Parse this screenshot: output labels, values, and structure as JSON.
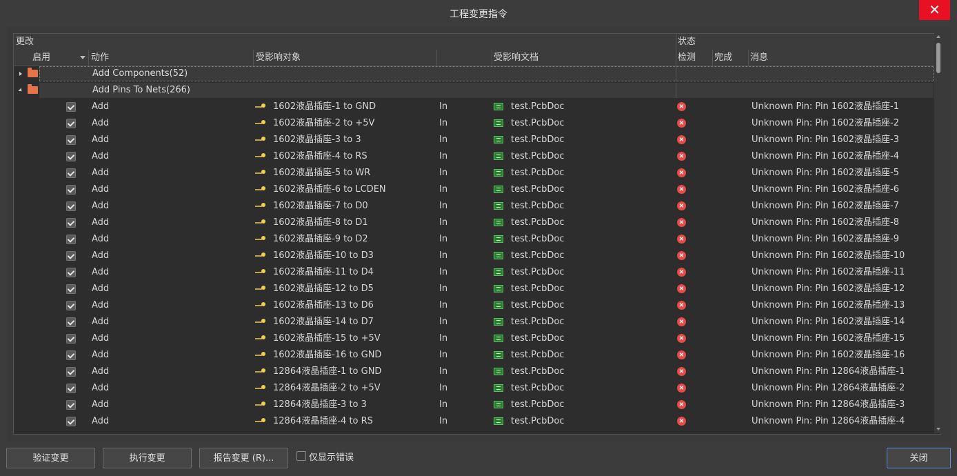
{
  "window": {
    "title": "工程变更指令",
    "close_glyph": "✕"
  },
  "groups": {
    "modify": "更改",
    "status": "状态"
  },
  "columns": {
    "enable": "启用",
    "action": "动作",
    "affected_object": "受影响对象",
    "affected_doc": "受影响文档",
    "check": "检测",
    "done": "完成",
    "message": "消息"
  },
  "tree": [
    {
      "label": "Add Components(52)",
      "expanded": false
    },
    {
      "label": "Add Pins To Nets(266)",
      "expanded": true
    }
  ],
  "rows": [
    {
      "action": "Add",
      "object": "1602液晶插座-1 to GND",
      "dir": "In",
      "doc": "test.PcbDoc",
      "message": "Unknown Pin: Pin 1602液晶插座-1"
    },
    {
      "action": "Add",
      "object": "1602液晶插座-2 to +5V",
      "dir": "In",
      "doc": "test.PcbDoc",
      "message": "Unknown Pin: Pin 1602液晶插座-2"
    },
    {
      "action": "Add",
      "object": "1602液晶插座-3 to 3",
      "dir": "In",
      "doc": "test.PcbDoc",
      "message": "Unknown Pin: Pin 1602液晶插座-3"
    },
    {
      "action": "Add",
      "object": "1602液晶插座-4 to RS",
      "dir": "In",
      "doc": "test.PcbDoc",
      "message": "Unknown Pin: Pin 1602液晶插座-4"
    },
    {
      "action": "Add",
      "object": "1602液晶插座-5 to WR",
      "dir": "In",
      "doc": "test.PcbDoc",
      "message": "Unknown Pin: Pin 1602液晶插座-5"
    },
    {
      "action": "Add",
      "object": "1602液晶插座-6 to LCDEN",
      "dir": "In",
      "doc": "test.PcbDoc",
      "message": "Unknown Pin: Pin 1602液晶插座-6"
    },
    {
      "action": "Add",
      "object": "1602液晶插座-7 to D0",
      "dir": "In",
      "doc": "test.PcbDoc",
      "message": "Unknown Pin: Pin 1602液晶插座-7"
    },
    {
      "action": "Add",
      "object": "1602液晶插座-8 to D1",
      "dir": "In",
      "doc": "test.PcbDoc",
      "message": "Unknown Pin: Pin 1602液晶插座-8"
    },
    {
      "action": "Add",
      "object": "1602液晶插座-9 to D2",
      "dir": "In",
      "doc": "test.PcbDoc",
      "message": "Unknown Pin: Pin 1602液晶插座-9"
    },
    {
      "action": "Add",
      "object": "1602液晶插座-10 to D3",
      "dir": "In",
      "doc": "test.PcbDoc",
      "message": "Unknown Pin: Pin 1602液晶插座-10"
    },
    {
      "action": "Add",
      "object": "1602液晶插座-11 to D4",
      "dir": "In",
      "doc": "test.PcbDoc",
      "message": "Unknown Pin: Pin 1602液晶插座-11"
    },
    {
      "action": "Add",
      "object": "1602液晶插座-12 to D5",
      "dir": "In",
      "doc": "test.PcbDoc",
      "message": "Unknown Pin: Pin 1602液晶插座-12"
    },
    {
      "action": "Add",
      "object": "1602液晶插座-13 to D6",
      "dir": "In",
      "doc": "test.PcbDoc",
      "message": "Unknown Pin: Pin 1602液晶插座-13"
    },
    {
      "action": "Add",
      "object": "1602液晶插座-14 to D7",
      "dir": "In",
      "doc": "test.PcbDoc",
      "message": "Unknown Pin: Pin 1602液晶插座-14"
    },
    {
      "action": "Add",
      "object": "1602液晶插座-15 to +5V",
      "dir": "In",
      "doc": "test.PcbDoc",
      "message": "Unknown Pin: Pin 1602液晶插座-15"
    },
    {
      "action": "Add",
      "object": "1602液晶插座-16 to GND",
      "dir": "In",
      "doc": "test.PcbDoc",
      "message": "Unknown Pin: Pin 1602液晶插座-16"
    },
    {
      "action": "Add",
      "object": "12864液晶插座-1 to GND",
      "dir": "In",
      "doc": "test.PcbDoc",
      "message": "Unknown Pin: Pin 12864液晶插座-1"
    },
    {
      "action": "Add",
      "object": "12864液晶插座-2 to +5V",
      "dir": "In",
      "doc": "test.PcbDoc",
      "message": "Unknown Pin: Pin 12864液晶插座-2"
    },
    {
      "action": "Add",
      "object": "12864液晶插座-3 to 3",
      "dir": "In",
      "doc": "test.PcbDoc",
      "message": "Unknown Pin: Pin 12864液晶插座-3"
    },
    {
      "action": "Add",
      "object": "12864液晶插座-4 to RS",
      "dir": "In",
      "doc": "test.PcbDoc",
      "message": "Unknown Pin: Pin 12864液晶插座-4"
    }
  ],
  "buttons": {
    "validate": "验证变更",
    "execute": "执行变更",
    "report": "报告变更 (R)...",
    "show_errors": "仅显示错误",
    "close": "关闭"
  },
  "icons": {
    "folder": "folder-icon",
    "pin": "pin-icon",
    "pcb": "pcb-doc-icon",
    "error": "error-icon",
    "colors": {
      "folder": "#e8734a",
      "error": "#e84a4a",
      "pcb": "#2f7d32",
      "pin": "#f2d14a",
      "close_bg": "#e81123"
    }
  }
}
